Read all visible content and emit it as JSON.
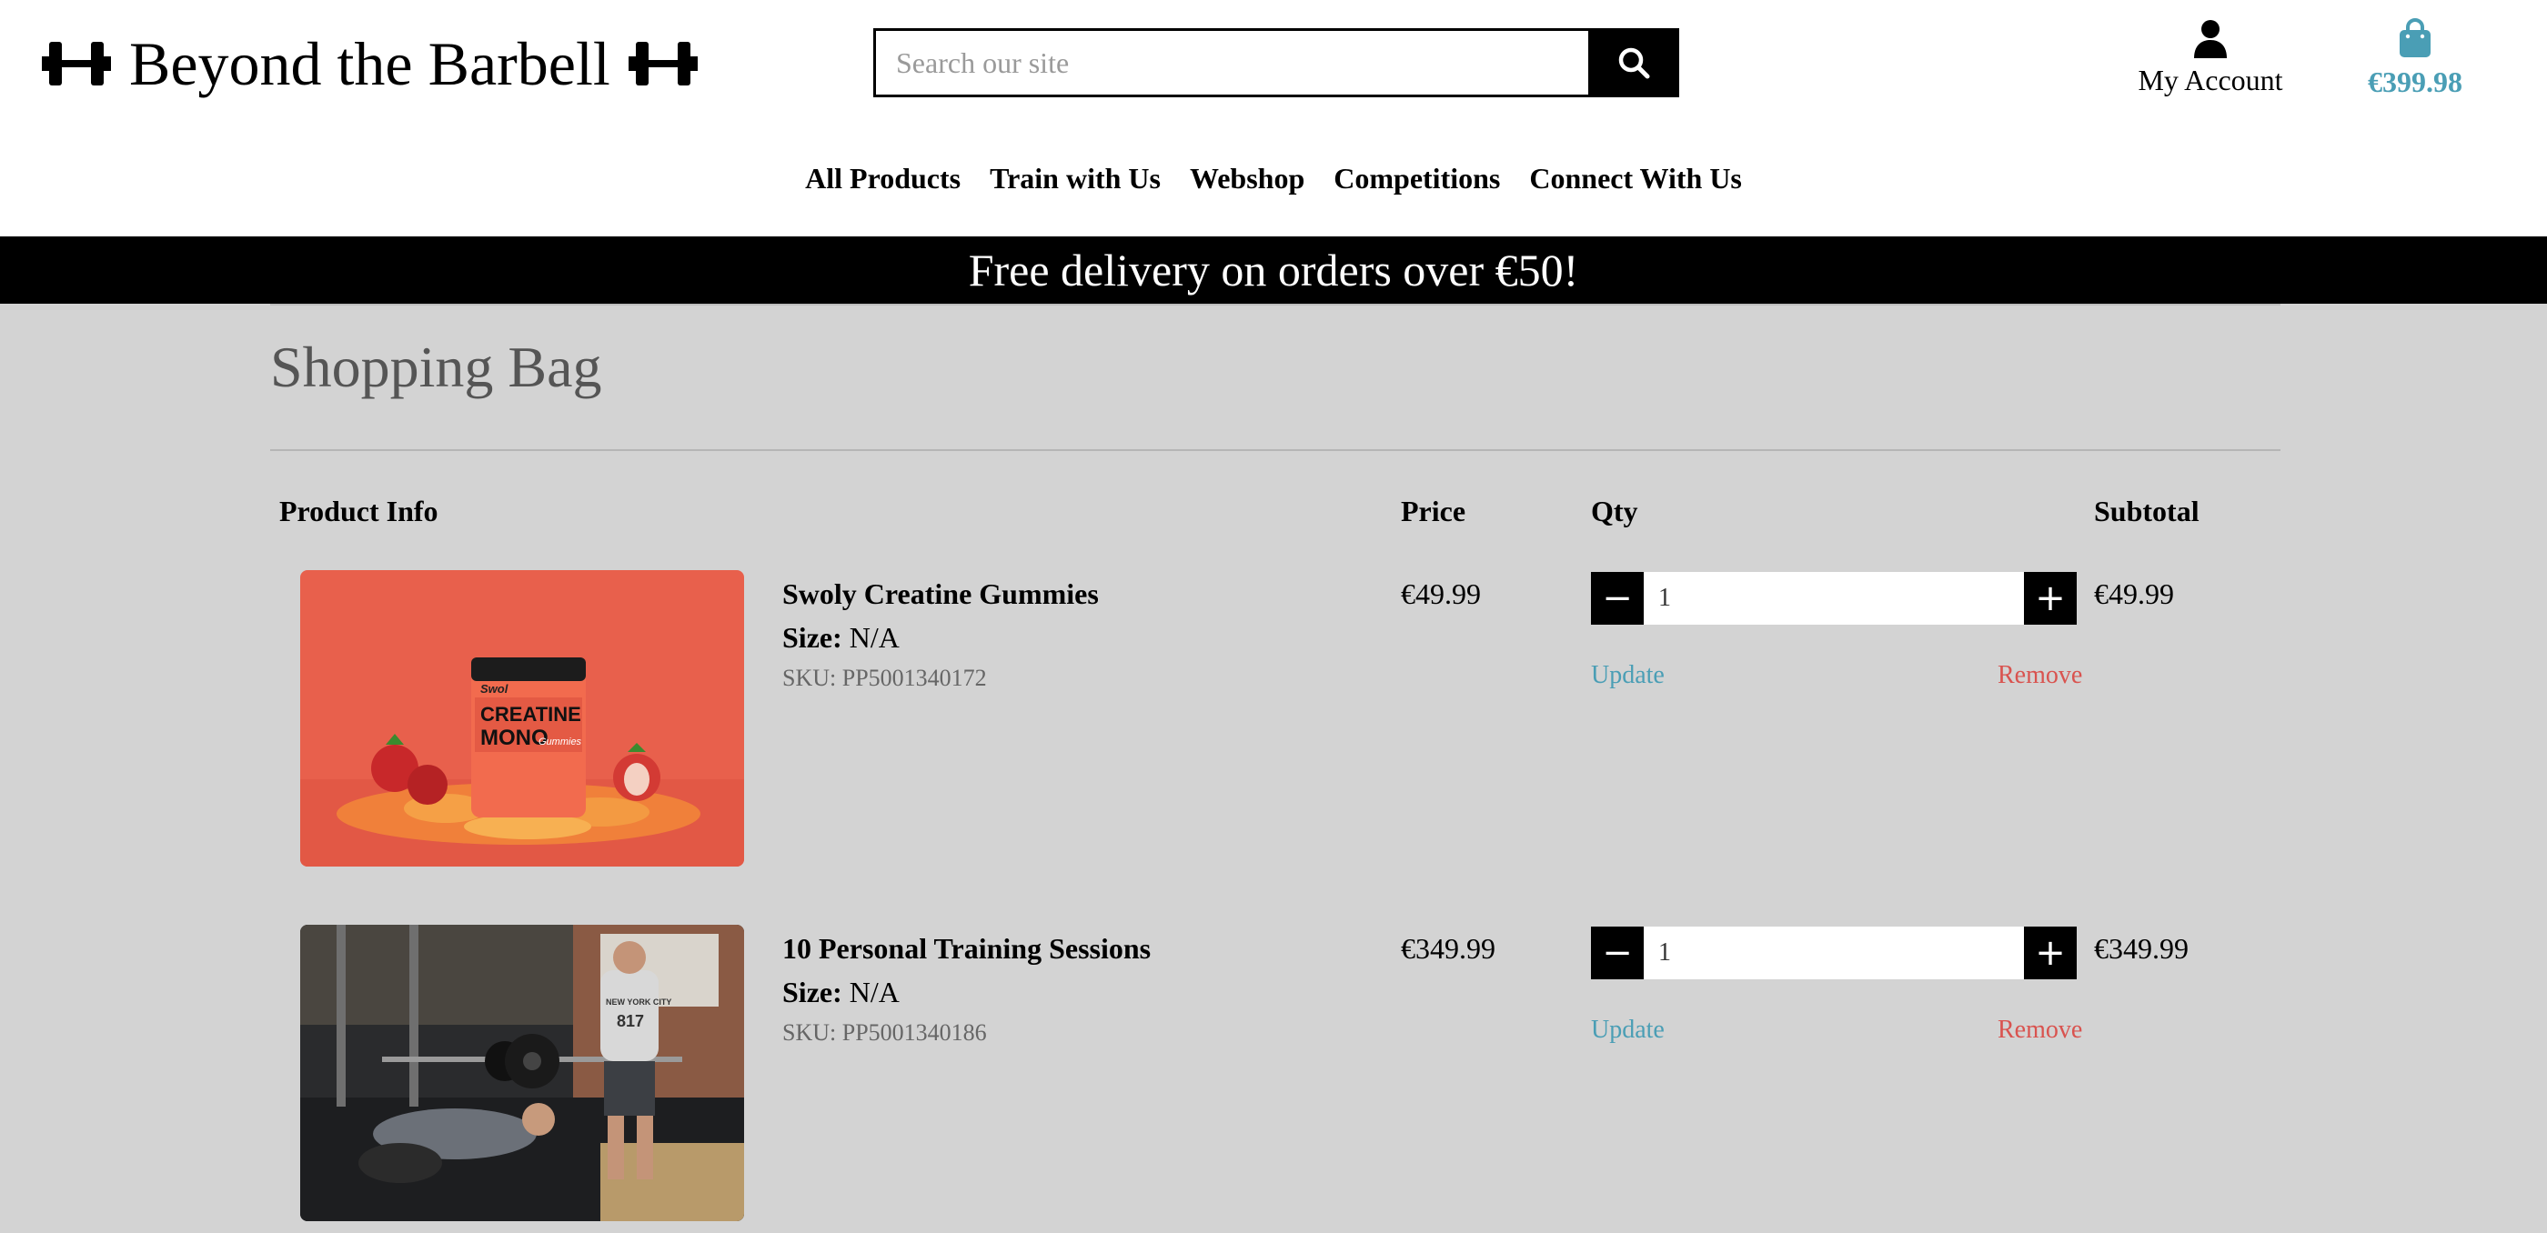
{
  "header": {
    "logo_text": "Beyond the Barbell",
    "search_placeholder": "Search our site",
    "account_label": "My Account",
    "bag_total": "€399.98"
  },
  "nav": [
    "All Products",
    "Train with Us",
    "Webshop",
    "Competitions",
    "Connect With Us"
  ],
  "banner": "Free delivery on orders over €50!",
  "page_title": "Shopping Bag",
  "columns": {
    "product_info": "Product Info",
    "price": "Price",
    "qty": "Qty",
    "subtotal": "Subtotal"
  },
  "items": [
    {
      "name": "Swoly Creatine Gummies",
      "size_label": "Size:",
      "size_value": "N/A",
      "sku": "SKU: PP5001340172",
      "price": "€49.99",
      "qty": "1",
      "subtotal": "€49.99",
      "update_label": "Update",
      "remove_label": "Remove",
      "image_text": [
        "Swol",
        "CREATINE",
        "MONO",
        "Gummies"
      ]
    },
    {
      "name": "10 Personal Training Sessions",
      "size_label": "Size:",
      "size_value": "N/A",
      "sku": "SKU: PP5001340186",
      "price": "€349.99",
      "qty": "1",
      "subtotal": "€349.99",
      "update_label": "Update",
      "remove_label": "Remove",
      "image_text": [
        "NEW YORK CITY",
        "817"
      ]
    }
  ],
  "colors": {
    "accent": "#4a9eb5",
    "remove": "#d9534f",
    "banner_bg": "#000000",
    "page_bg": "#d3d3d3"
  }
}
